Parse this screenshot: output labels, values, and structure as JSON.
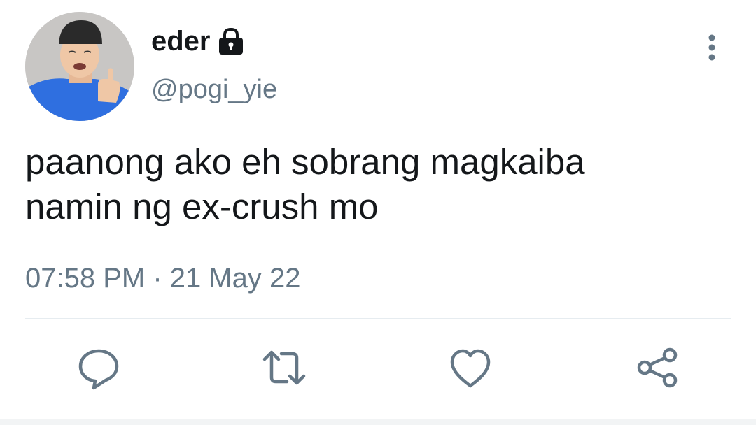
{
  "tweet": {
    "author": {
      "display_name": "eder",
      "handle": "@pogi_yie",
      "protected_icon": "lock-icon",
      "avatar": "profile-photo"
    },
    "text": "paanong ako eh sobrang magkaiba\nnamin ng ex-crush mo",
    "timestamp": "07:58 PM · 21 May 22",
    "more_icon": "more-vertical-icon"
  },
  "actions": [
    {
      "name": "reply",
      "icon": "reply-icon"
    },
    {
      "name": "retweet",
      "icon": "retweet-icon"
    },
    {
      "name": "like",
      "icon": "heart-icon"
    },
    {
      "name": "share",
      "icon": "share-icon"
    }
  ],
  "colors": {
    "text_primary": "#14171a",
    "text_secondary": "#657786",
    "divider": "#e6ecf0"
  }
}
